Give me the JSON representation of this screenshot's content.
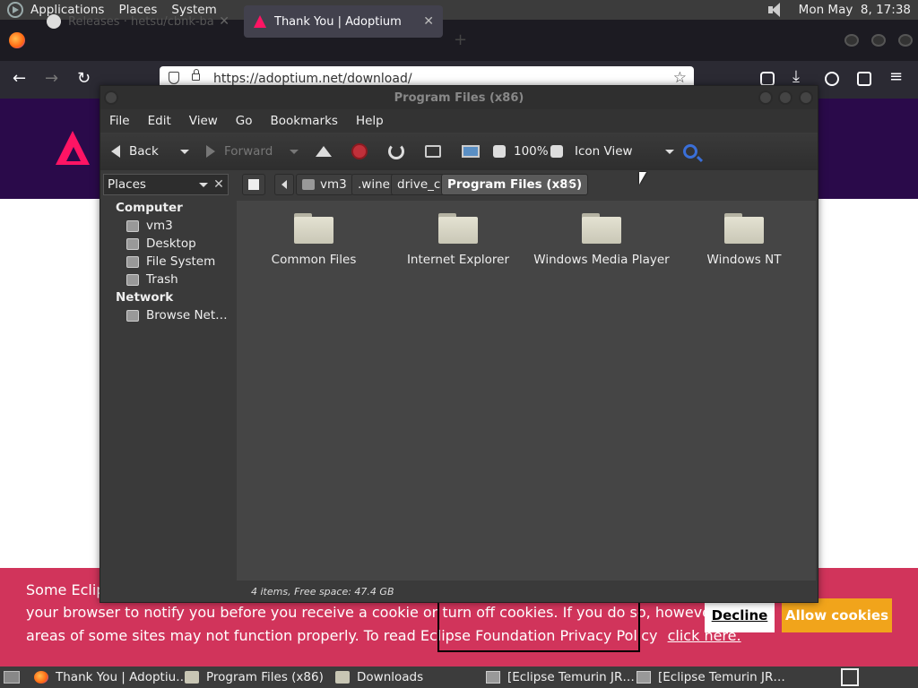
{
  "top_panel": {
    "menus": [
      "Applications",
      "Places",
      "System"
    ],
    "clock": "Mon May  8, 17:38"
  },
  "firefox": {
    "tabs": [
      {
        "label": "Releases · hetsu/cbnk-ba"
      },
      {
        "label": "Thank You | Adoptium"
      }
    ],
    "url": "https://adoptium.net/download/"
  },
  "cookie_banner": {
    "line1": "Some Eclip",
    "line2": "your browser to notify you before you receive a cookie or turn off cookies. If you do so, however, some",
    "line3": "areas of some sites may not function properly. To read Eclipse Foundation Privacy Policy",
    "link": "click here.",
    "decline_label": "Decline",
    "allow_label": "Allow cookies",
    "color": "#d1345b"
  },
  "file_manager": {
    "title": "Program Files (x86)",
    "menus": [
      "File",
      "Edit",
      "View",
      "Go",
      "Bookmarks",
      "Help"
    ],
    "toolbar": {
      "back": "Back",
      "forward": "Forward",
      "zoom": "100%",
      "view_mode": "Icon View"
    },
    "sidebar": {
      "selector": "Places",
      "sections": [
        {
          "heading": "Computer",
          "items": [
            "vm3",
            "Desktop",
            "File System",
            "Trash"
          ]
        },
        {
          "heading": "Network",
          "items": [
            "Browse Net…"
          ]
        }
      ]
    },
    "path": [
      "vm3",
      ".wine",
      "drive_c",
      "Program Files (x86)"
    ],
    "files": [
      "Common Files",
      "Internet Explorer",
      "Windows Media Player",
      "Windows NT"
    ],
    "status": "4 items, Free space: 47.4 GB"
  },
  "taskbar": {
    "tasks": [
      {
        "label": "Thank You | Adoptiu…",
        "icon": "firefox-icon"
      },
      {
        "label": "Program Files (x86)",
        "icon": "folder-icon"
      },
      {
        "label": "Downloads",
        "icon": "folder-icon"
      },
      {
        "label": "[Eclipse Temurin JR…",
        "icon": "window-icon"
      },
      {
        "label": "[Eclipse Temurin JR…",
        "icon": "window-icon"
      }
    ]
  }
}
